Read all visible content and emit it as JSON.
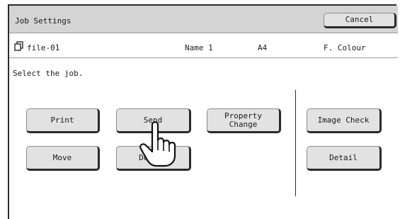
{
  "header": {
    "title": "Job Settings",
    "cancel_label": "Cancel"
  },
  "file": {
    "icon": "document-stack-icon",
    "name": "file-01",
    "user": "Name 1",
    "paper_size": "A4",
    "color_mode": "F. Colour"
  },
  "instruction": "Select the job.",
  "buttons": {
    "print": "Print",
    "send": "Send",
    "property_change": "Property\nChange",
    "image_check": "Image Check",
    "move": "Move",
    "delete": "Delete",
    "detail": "Detail"
  }
}
